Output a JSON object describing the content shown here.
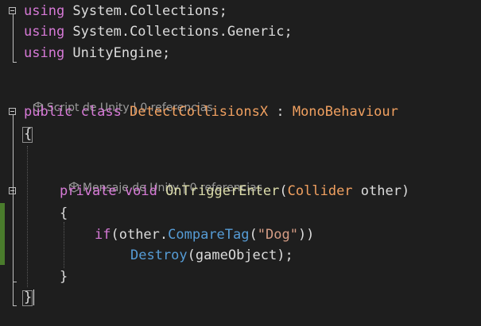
{
  "editor": {
    "line1": {
      "kw": "using",
      "rest": " System.Collections;"
    },
    "line2": {
      "kw": "using",
      "rest": " System.Collections.Generic;"
    },
    "line3": {
      "kw": "using",
      "rest": " UnityEngine;"
    },
    "class_lens": {
      "script": "Script de Unity",
      "sep": " | ",
      "refs": "0 referencias"
    },
    "class_decl": {
      "public": "public",
      "class": "class",
      "name": "DetectCollisionsX",
      "colon": " : ",
      "base": "MonoBehaviour"
    },
    "open_brace": "{",
    "method_lens": {
      "script": "Mensaje de Unity",
      "sep": " | ",
      "refs": "0 referencias"
    },
    "method_decl": {
      "private": "private",
      "void": "void",
      "name": "OnTriggerEnter",
      "open": "(",
      "ptype": "Collider",
      "pname": " other",
      "close": ")"
    },
    "method_open": "{",
    "if_line": {
      "if": "if",
      "pre": "(other.",
      "method": "CompareTag",
      "open": "(",
      "str": "\"Dog\"",
      "close": "))"
    },
    "destroy_line": {
      "method": "Destroy",
      "args": "(gameObject);"
    },
    "method_close": "}",
    "class_close": "}"
  }
}
